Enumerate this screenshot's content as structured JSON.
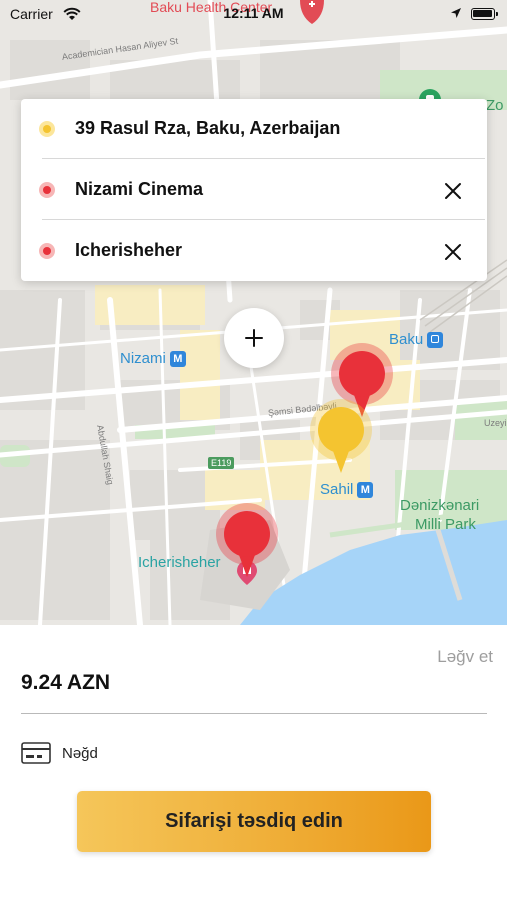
{
  "status_bar": {
    "carrier": "Carrier",
    "time": "12:11 AM"
  },
  "map": {
    "labels": {
      "top_poi": "Baku Health Center",
      "street_top": "Academician Hasan Aliyev St",
      "street_abdullah": "Abdullah Shaig",
      "street_semsi": "Şəmsi Bədəlbəyli",
      "street_uzey": "Uzeyir",
      "zoo": "Zo",
      "nizami": "Nizami",
      "metro_letter": "M",
      "baku": "Baku",
      "route_badge": "E119",
      "sahil": "Sahil",
      "park_line1": "Dənizkənari",
      "park_line2": "Milli Park",
      "icherisheher": "Icherisheher"
    },
    "colors": {
      "land": "#e9e7e3",
      "road": "#ffffff",
      "block": "#dedcd8",
      "highlight": "#f8edc2",
      "green": "#cfe6c8",
      "water": "#a6d4f8",
      "pin_origin": "#f4c430",
      "pin_destination": "#e8313a"
    }
  },
  "route": {
    "stops": [
      {
        "type": "origin",
        "label": "39 Rasul Rza, Baku, Azerbaijan",
        "removable": false
      },
      {
        "type": "destination",
        "label": "Nizami Cinema",
        "removable": true
      },
      {
        "type": "destination",
        "label": "Icherisheher",
        "removable": true
      }
    ],
    "remove_icon": "close-icon",
    "add_stop_icon": "plus-icon"
  },
  "order": {
    "cancel_label": "Ləğv et",
    "price": "9.24 AZN",
    "payment_method": "Nəğd",
    "payment_icon": "credit-card-icon",
    "confirm_label": "Sifarişi təsdiq edin",
    "accent_start": "#f5c65a",
    "accent_end": "#ea9818"
  }
}
